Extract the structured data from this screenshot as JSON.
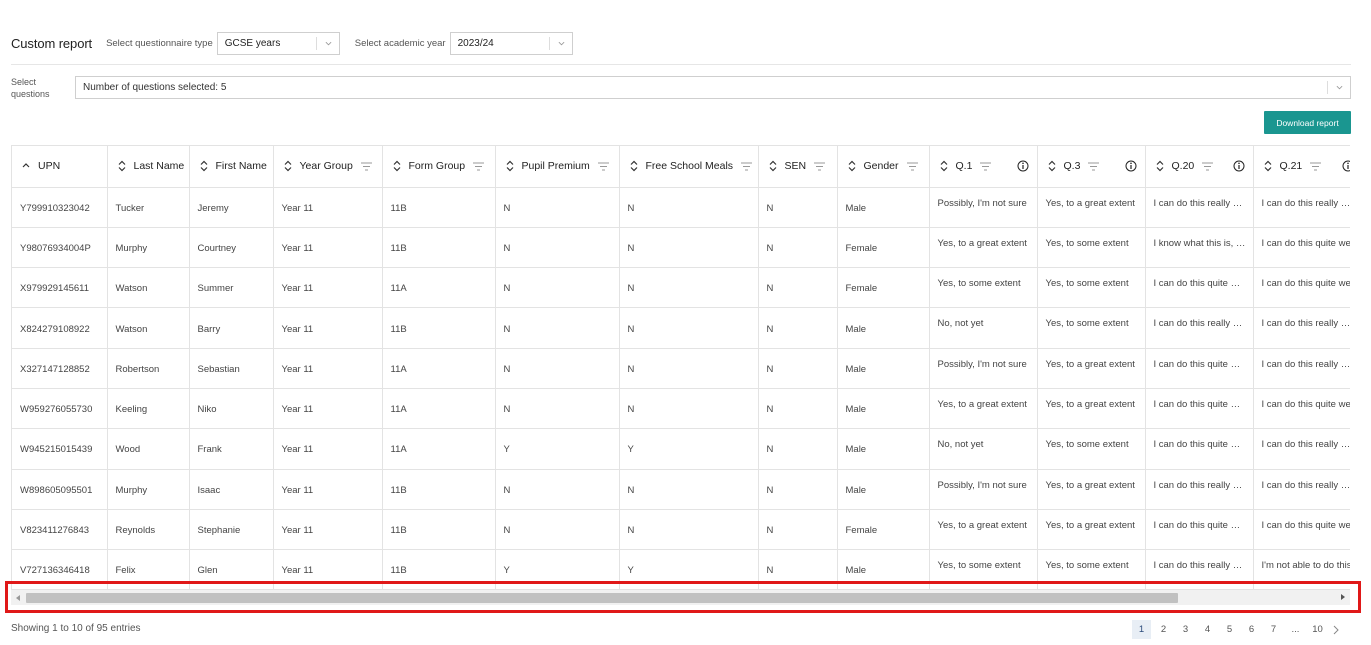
{
  "header": {
    "title": "Custom report",
    "questionnaire_label": "Select questionnaire type",
    "questionnaire_value": "GCSE years",
    "year_label": "Select academic year",
    "year_value": "2023/24"
  },
  "questions": {
    "label": "Select questions",
    "value": "Number of questions selected: 5"
  },
  "download_label": "Download report",
  "table": {
    "columns": [
      "UPN",
      "Last Name",
      "First Name",
      "Year Group",
      "Form Group",
      "Pupil Premium",
      "Free School Meals",
      "SEN",
      "Gender",
      "Q.1",
      "Q.3",
      "Q.20",
      "Q.21"
    ],
    "rows": [
      [
        "Y799910323042",
        "Tucker",
        "Jeremy",
        "Year 11",
        "11B",
        "N",
        "N",
        "N",
        "Male",
        "Possibly, I'm not sure",
        "Yes, to a great extent",
        "I can do this really well",
        "I can do this really well"
      ],
      [
        "Y98076934004P",
        "Murphy",
        "Courtney",
        "Year 11",
        "11B",
        "N",
        "N",
        "N",
        "Female",
        "Yes, to a great extent",
        "Yes, to some extent",
        "I know what this is, but",
        "I can do this quite well"
      ],
      [
        "X979929145611",
        "Watson",
        "Summer",
        "Year 11",
        "11A",
        "N",
        "N",
        "N",
        "Female",
        "Yes, to some extent",
        "Yes, to some extent",
        "I can do this quite well",
        "I can do this quite well"
      ],
      [
        "X824279108922",
        "Watson",
        "Barry",
        "Year 11",
        "11B",
        "N",
        "N",
        "N",
        "Male",
        "No, not yet",
        "Yes, to some extent",
        "I can do this really well",
        "I can do this really well"
      ],
      [
        "X327147128852",
        "Robertson",
        "Sebastian",
        "Year 11",
        "11A",
        "N",
        "N",
        "N",
        "Male",
        "Possibly, I'm not sure",
        "Yes, to a great extent",
        "I can do this quite well",
        "I can do this really well"
      ],
      [
        "W959276055730",
        "Keeling",
        "Niko",
        "Year 11",
        "11A",
        "N",
        "N",
        "N",
        "Male",
        "Yes, to a great extent",
        "Yes, to a great extent",
        "I can do this quite well",
        "I can do this quite well"
      ],
      [
        "W945215015439",
        "Wood",
        "Frank",
        "Year 11",
        "11A",
        "Y",
        "Y",
        "N",
        "Male",
        "No, not yet",
        "Yes, to some extent",
        "I can do this quite well",
        "I can do this really well"
      ],
      [
        "W898605095501",
        "Murphy",
        "Isaac",
        "Year 11",
        "11B",
        "N",
        "N",
        "N",
        "Male",
        "Possibly, I'm not sure",
        "Yes, to a great extent",
        "I can do this really well",
        "I can do this really well"
      ],
      [
        "V823411276843",
        "Reynolds",
        "Stephanie",
        "Year 11",
        "11B",
        "N",
        "N",
        "N",
        "Female",
        "Yes, to a great extent",
        "Yes, to a great extent",
        "I can do this quite well",
        "I can do this quite well"
      ],
      [
        "V727136346418",
        "Felix",
        "Glen",
        "Year 11",
        "11B",
        "Y",
        "Y",
        "N",
        "Male",
        "Yes, to some extent",
        "Yes, to some extent",
        "I can do this really well",
        "I'm not able to do this"
      ]
    ]
  },
  "scroll": {
    "thumb_fraction": 0.88
  },
  "footer": {
    "entries_text": "Showing 1 to 10 of 95 entries",
    "pages": [
      "1",
      "2",
      "3",
      "4",
      "5",
      "6",
      "7",
      "...",
      "10"
    ],
    "active_page": "1"
  },
  "colors": {
    "accent": "#1a9690",
    "highlight": "#e01818"
  }
}
